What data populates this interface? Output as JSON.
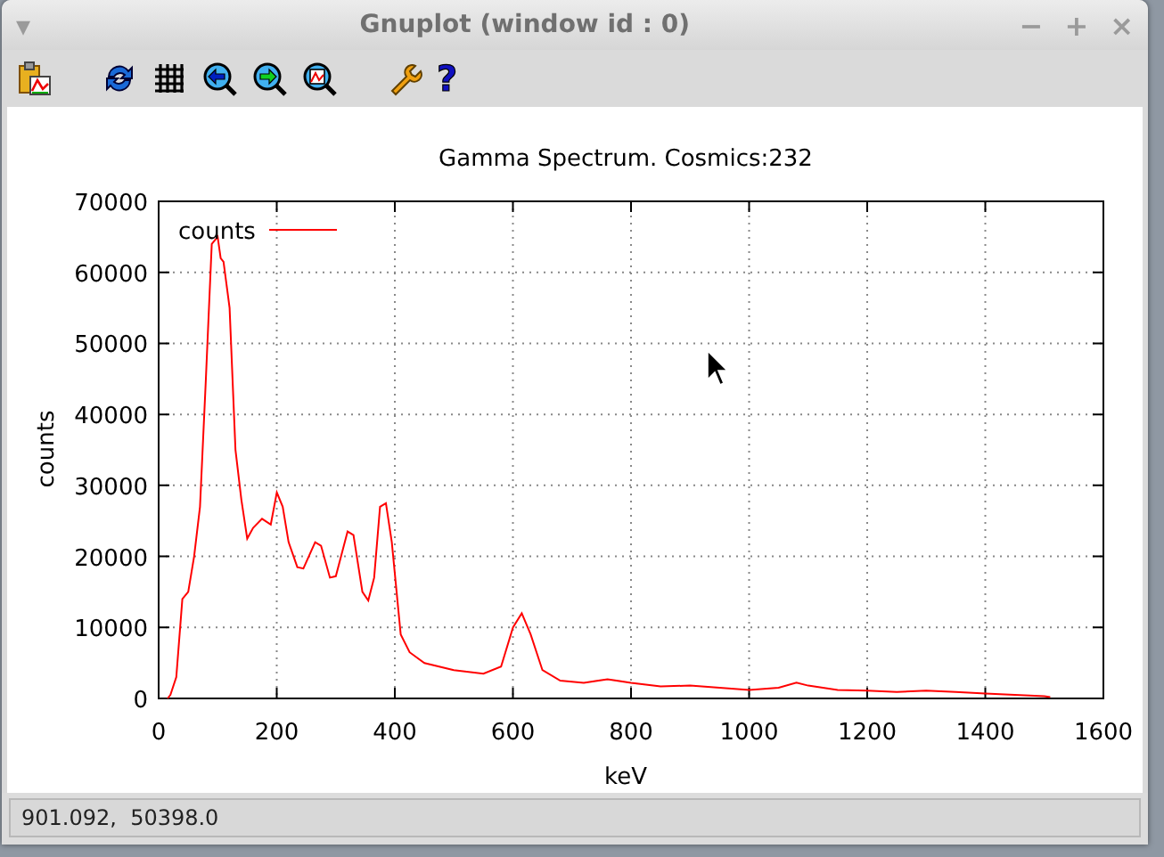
{
  "window": {
    "title": "Gnuplot (window id : 0)",
    "menu_glyph": "▾",
    "controls": [
      "−",
      "+",
      "×"
    ]
  },
  "toolbar": {
    "help_glyph": "?"
  },
  "plot": {
    "chart_data": {
      "type": "line",
      "grid": true,
      "title": "Gamma Spectrum.  Cosmics:232",
      "xlabel": "keV",
      "ylabel": "counts",
      "xlim": [
        0,
        1600
      ],
      "ylim": [
        0,
        70000
      ],
      "xticks": [
        0,
        200,
        400,
        600,
        800,
        1000,
        1200,
        1400,
        1600
      ],
      "yticks": [
        0,
        10000,
        20000,
        30000,
        40000,
        50000,
        60000,
        70000
      ],
      "x": [
        15,
        20,
        30,
        40,
        50,
        60,
        70,
        80,
        90,
        100,
        105,
        110,
        120,
        130,
        140,
        150,
        160,
        175,
        190,
        200,
        210,
        220,
        235,
        245,
        265,
        275,
        290,
        300,
        320,
        330,
        345,
        355,
        365,
        375,
        385,
        395,
        410,
        425,
        450,
        500,
        550,
        580,
        600,
        615,
        630,
        650,
        680,
        720,
        760,
        800,
        850,
        900,
        950,
        1000,
        1050,
        1080,
        1100,
        1150,
        1200,
        1250,
        1300,
        1350,
        1400,
        1450,
        1500,
        1510
      ],
      "series": [
        {
          "name": "counts",
          "color": "#ff0000",
          "values": [
            0,
            500,
            3000,
            14000,
            15000,
            20000,
            27000,
            45000,
            64000,
            65000,
            62000,
            61500,
            55000,
            35000,
            28000,
            22500,
            24000,
            25300,
            24500,
            29000,
            27000,
            22000,
            18500,
            18300,
            22000,
            21500,
            17000,
            17200,
            23500,
            23000,
            15000,
            13800,
            17000,
            27000,
            27500,
            22000,
            9000,
            6500,
            5000,
            4000,
            3500,
            4500,
            10000,
            12000,
            9000,
            4000,
            2500,
            2200,
            2700,
            2200,
            1700,
            1800,
            1500,
            1200,
            1500,
            2200,
            1800,
            1200,
            1100,
            900,
            1100,
            900,
            700,
            500,
            300,
            200
          ]
        }
      ]
    }
  },
  "status_bar": {
    "text": "901.092,  50398.0"
  }
}
